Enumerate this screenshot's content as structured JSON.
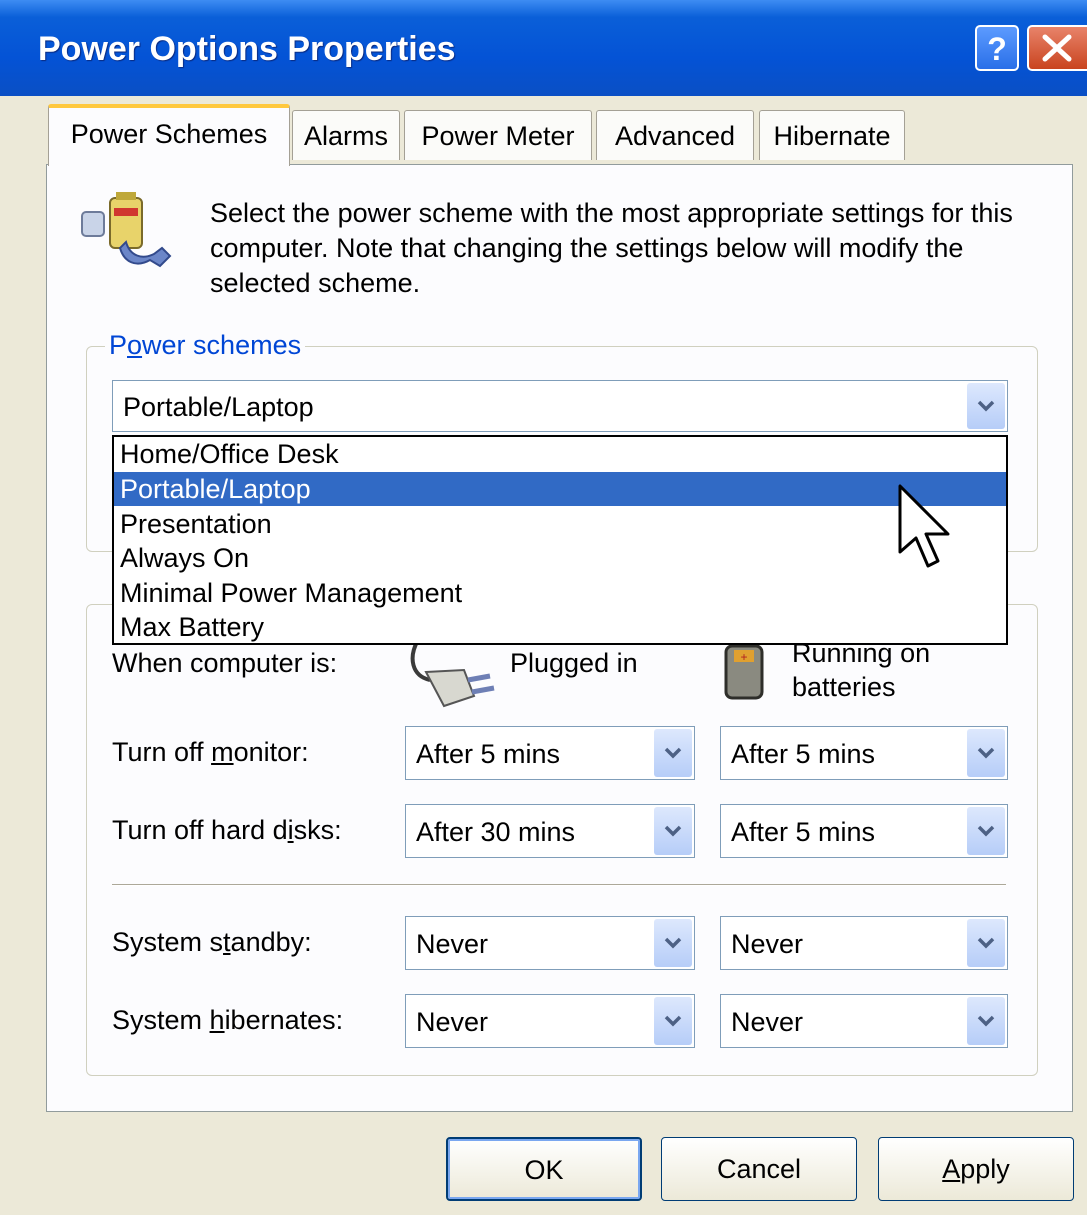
{
  "window": {
    "title": "Power Options Properties"
  },
  "tabs": [
    {
      "label": "Power Schemes",
      "active": true
    },
    {
      "label": "Alarms",
      "active": false
    },
    {
      "label": "Power Meter",
      "active": false
    },
    {
      "label": "Advanced",
      "active": false
    },
    {
      "label": "Hibernate",
      "active": false
    }
  ],
  "description": "Select the power scheme with the most appropriate settings for this computer. Note that changing the settings below will modify the selected scheme.",
  "power_schemes": {
    "group_label": "Power schemes",
    "selected": "Portable/Laptop",
    "options": [
      "Home/Office Desk",
      "Portable/Laptop",
      "Presentation",
      "Always On",
      "Minimal Power Management",
      "Max Battery"
    ],
    "highlighted_index": 1
  },
  "settings": {
    "when_label": "When computer is:",
    "plugged_in_label": "Plugged in",
    "batteries_label_line1": "Running on",
    "batteries_label_line2": "batteries",
    "rows": [
      {
        "label_pre": "Turn off ",
        "label_key": "m",
        "label_post": "onitor:",
        "plugged": "After 5 mins",
        "battery": "After 5 mins"
      },
      {
        "label_pre": "Turn off hard d",
        "label_key": "i",
        "label_post": "sks:",
        "plugged": "After 30 mins",
        "battery": "After 5 mins"
      },
      {
        "label_pre": "System s",
        "label_key": "t",
        "label_post": "andby:",
        "plugged": "Never",
        "battery": "Never"
      },
      {
        "label_pre": "System ",
        "label_key": "h",
        "label_post": "ibernates:",
        "plugged": "Never",
        "battery": "Never"
      }
    ]
  },
  "buttons": {
    "ok": "OK",
    "cancel": "Cancel",
    "apply_key": "A",
    "apply_rest": "pply"
  },
  "icons": {
    "help": "question-mark-icon",
    "close": "close-x-icon",
    "scheme": "power-scheme-icon",
    "plug": "plug-icon",
    "battery": "battery-icon",
    "cursor": "mouse-cursor-icon",
    "dropdown": "chevron-down-icon"
  },
  "colors": {
    "titlebar": "#0453d6",
    "selection": "#316ac5",
    "group_label": "#0046d5",
    "tab_highlight": "#ffc83d"
  }
}
